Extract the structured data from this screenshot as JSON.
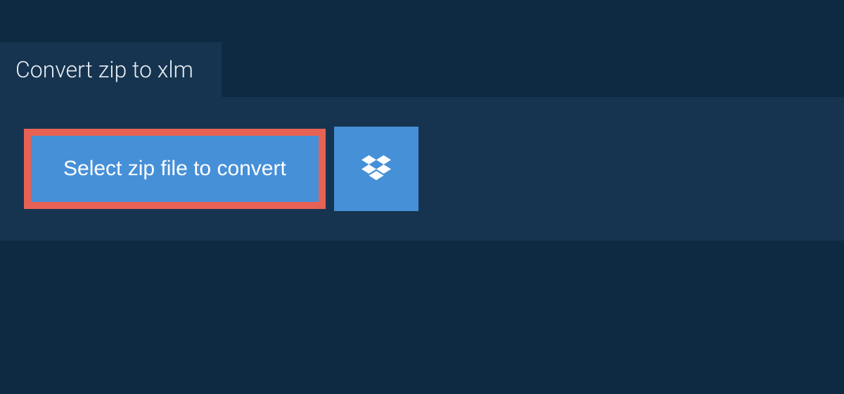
{
  "tab": {
    "title": "Convert zip to xlm"
  },
  "actions": {
    "select_file_label": "Select zip file to convert"
  },
  "icons": {
    "dropbox": "dropbox-icon"
  },
  "colors": {
    "background": "#0e2a42",
    "panel": "#163450",
    "button": "#4690d8",
    "highlight_border": "#e76254",
    "text_light": "#e8eef3",
    "button_text": "#ffffff"
  }
}
